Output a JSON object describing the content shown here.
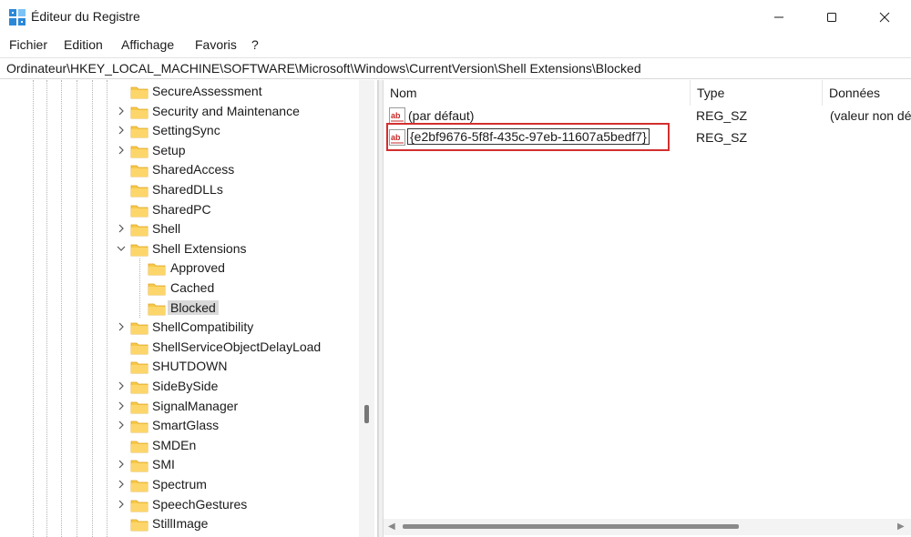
{
  "window": {
    "title": "Éditeur du Registre",
    "icon": "registry-editor-icon"
  },
  "menu": [
    "Fichier",
    "Edition",
    "Affichage",
    "Favoris",
    "?"
  ],
  "address": "Ordinateur\\HKEY_LOCAL_MACHINE\\SOFTWARE\\Microsoft\\Windows\\CurrentVersion\\Shell Extensions\\Blocked",
  "tree": {
    "items": [
      {
        "label": "SecureAssessment",
        "expander": "none",
        "level": 0
      },
      {
        "label": "Security and Maintenance",
        "expander": "collapsed",
        "level": 0
      },
      {
        "label": "SettingSync",
        "expander": "collapsed",
        "level": 0
      },
      {
        "label": "Setup",
        "expander": "collapsed",
        "level": 0
      },
      {
        "label": "SharedAccess",
        "expander": "none",
        "level": 0
      },
      {
        "label": "SharedDLLs",
        "expander": "none",
        "level": 0
      },
      {
        "label": "SharedPC",
        "expander": "none",
        "level": 0
      },
      {
        "label": "Shell",
        "expander": "collapsed",
        "level": 0
      },
      {
        "label": "Shell Extensions",
        "expander": "expanded",
        "level": 0
      },
      {
        "label": "Approved",
        "expander": "none",
        "level": 1
      },
      {
        "label": "Cached",
        "expander": "none",
        "level": 1
      },
      {
        "label": "Blocked",
        "expander": "none",
        "level": 1,
        "selected": true
      },
      {
        "label": "ShellCompatibility",
        "expander": "collapsed",
        "level": 0
      },
      {
        "label": "ShellServiceObjectDelayLoad",
        "expander": "none",
        "level": 0
      },
      {
        "label": "SHUTDOWN",
        "expander": "none",
        "level": 0
      },
      {
        "label": "SideBySide",
        "expander": "collapsed",
        "level": 0
      },
      {
        "label": "SignalManager",
        "expander": "collapsed",
        "level": 0
      },
      {
        "label": "SmartGlass",
        "expander": "collapsed",
        "level": 0
      },
      {
        "label": "SMDEn",
        "expander": "none",
        "level": 0
      },
      {
        "label": "SMI",
        "expander": "collapsed",
        "level": 0
      },
      {
        "label": "Spectrum",
        "expander": "collapsed",
        "level": 0
      },
      {
        "label": "SpeechGestures",
        "expander": "collapsed",
        "level": 0
      },
      {
        "label": "StillImage",
        "expander": "none",
        "level": 0
      }
    ]
  },
  "list": {
    "columns": [
      "Nom",
      "Type",
      "Données"
    ],
    "rows": [
      {
        "name": "(par défaut)",
        "type": "REG_SZ",
        "data": "(valeur non dé",
        "icon": "string-value-icon"
      },
      {
        "name": "{e2bf9676-5f8f-435c-97eb-11607a5bedf7}",
        "type": "REG_SZ",
        "data": "",
        "icon": "string-value-icon",
        "editing": true
      }
    ]
  },
  "colors": {
    "folder": "#f7c948",
    "folder_dark": "#e0a526",
    "highlight_border": "#d32f2f",
    "selection": "#d9d9d9"
  }
}
